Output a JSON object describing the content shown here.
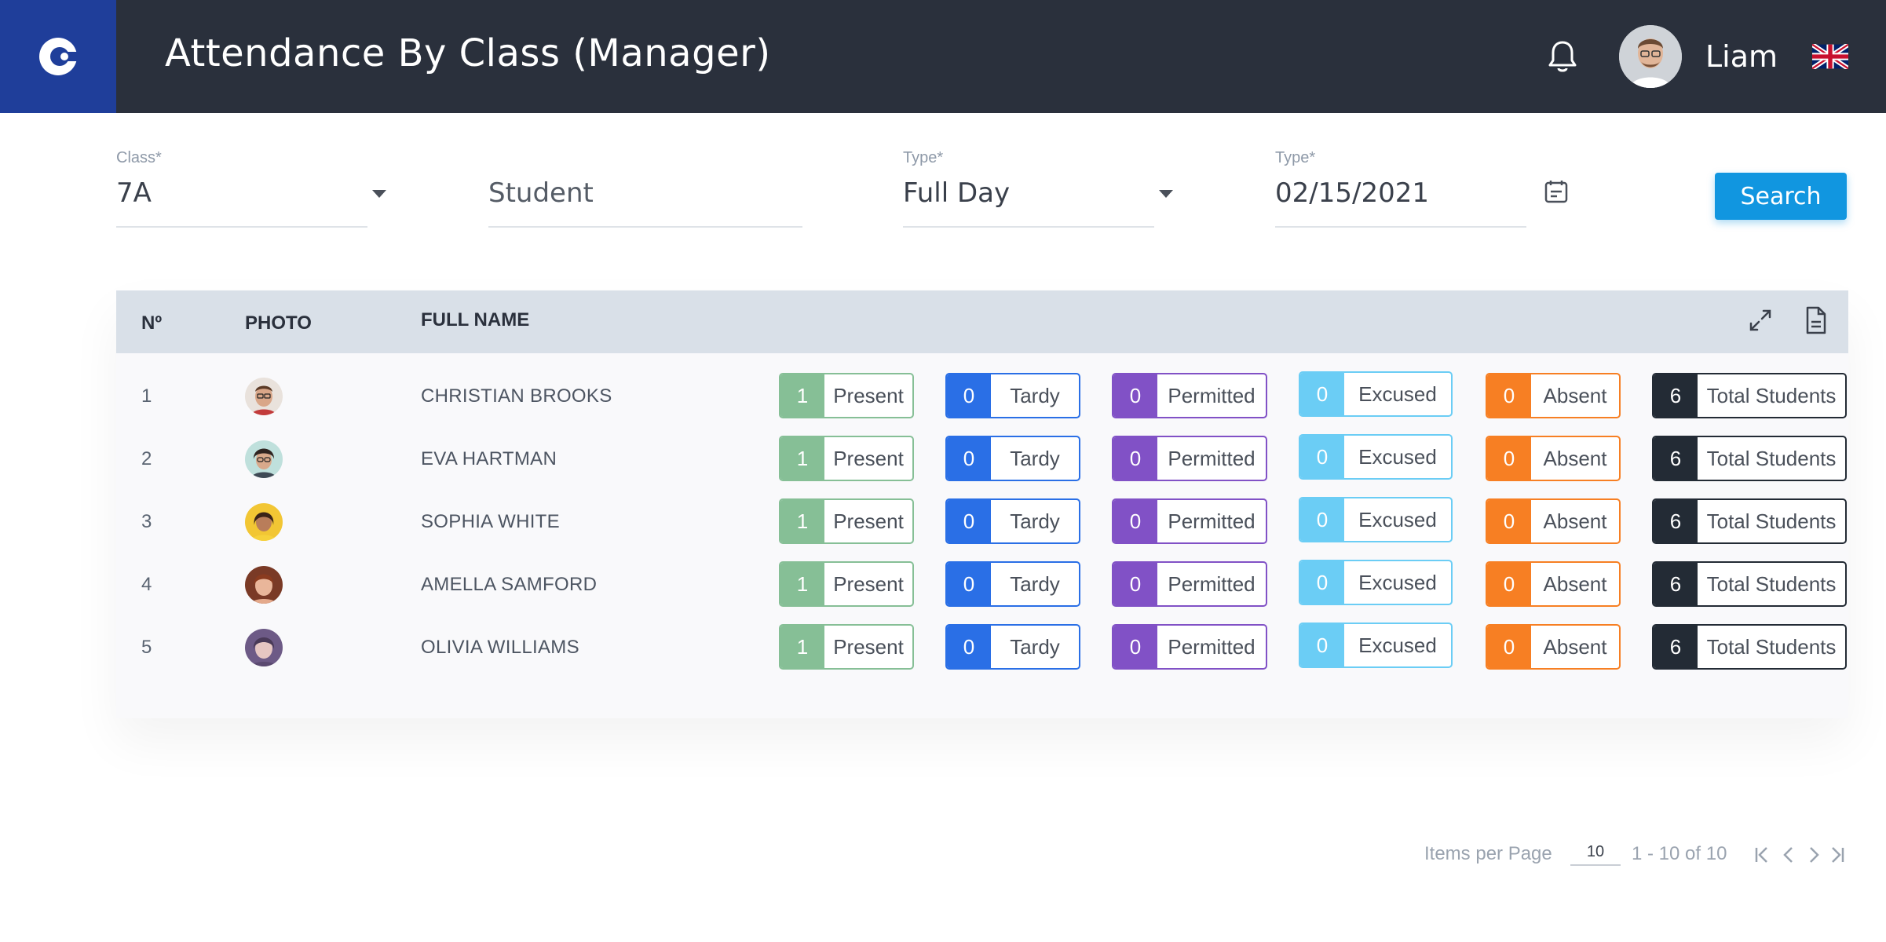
{
  "header": {
    "title": "Attendance By Class  (Manager)",
    "user_name": "Liam"
  },
  "filters": {
    "class_label": "Class*",
    "class_value": "7A",
    "student_placeholder": "Student",
    "type_label": "Type*",
    "type_value": "Full Day",
    "date_label": "Type*",
    "date_value": "02/15/2021",
    "search_label": "Search"
  },
  "table": {
    "columns": [
      "Nº",
      "PHOTO",
      "FULL NAME"
    ],
    "badge_labels": {
      "present": "Present",
      "tardy": "Tardy",
      "permitted": "Permitted",
      "excused": "Excused",
      "absent": "Absent",
      "total": "Total Students"
    },
    "rows": [
      {
        "no": "1",
        "name": "CHRISTIAN BROOKS",
        "present": "1",
        "tardy": "0",
        "permitted": "0",
        "excused": "0",
        "absent": "0",
        "total": "6"
      },
      {
        "no": "2",
        "name": "EVA HARTMAN",
        "present": "1",
        "tardy": "0",
        "permitted": "0",
        "excused": "0",
        "absent": "0",
        "total": "6"
      },
      {
        "no": "3",
        "name": "SOPHIA WHITE",
        "present": "1",
        "tardy": "0",
        "permitted": "0",
        "excused": "0",
        "absent": "0",
        "total": "6"
      },
      {
        "no": "4",
        "name": "AMELLA SAMFORD",
        "present": "1",
        "tardy": "0",
        "permitted": "0",
        "excused": "0",
        "absent": "0",
        "total": "6"
      },
      {
        "no": "5",
        "name": "OLIVIA WILLIAMS",
        "present": "1",
        "tardy": "0",
        "permitted": "0",
        "excused": "0",
        "absent": "0",
        "total": "6"
      }
    ]
  },
  "pagination": {
    "items_per_page_label": "Items per Page",
    "items_per_page_value": "10",
    "range_text": "1 - 10 of 10"
  },
  "colors": {
    "header_bg": "#2a303c",
    "logo_bg": "#1f3e9a",
    "accent": "#1196e0",
    "present": "#86bf96",
    "tardy": "#2a6fe6",
    "permitted": "#8151c6",
    "excused": "#6bcdf5",
    "absent": "#f77f23",
    "total": "#232b35"
  }
}
